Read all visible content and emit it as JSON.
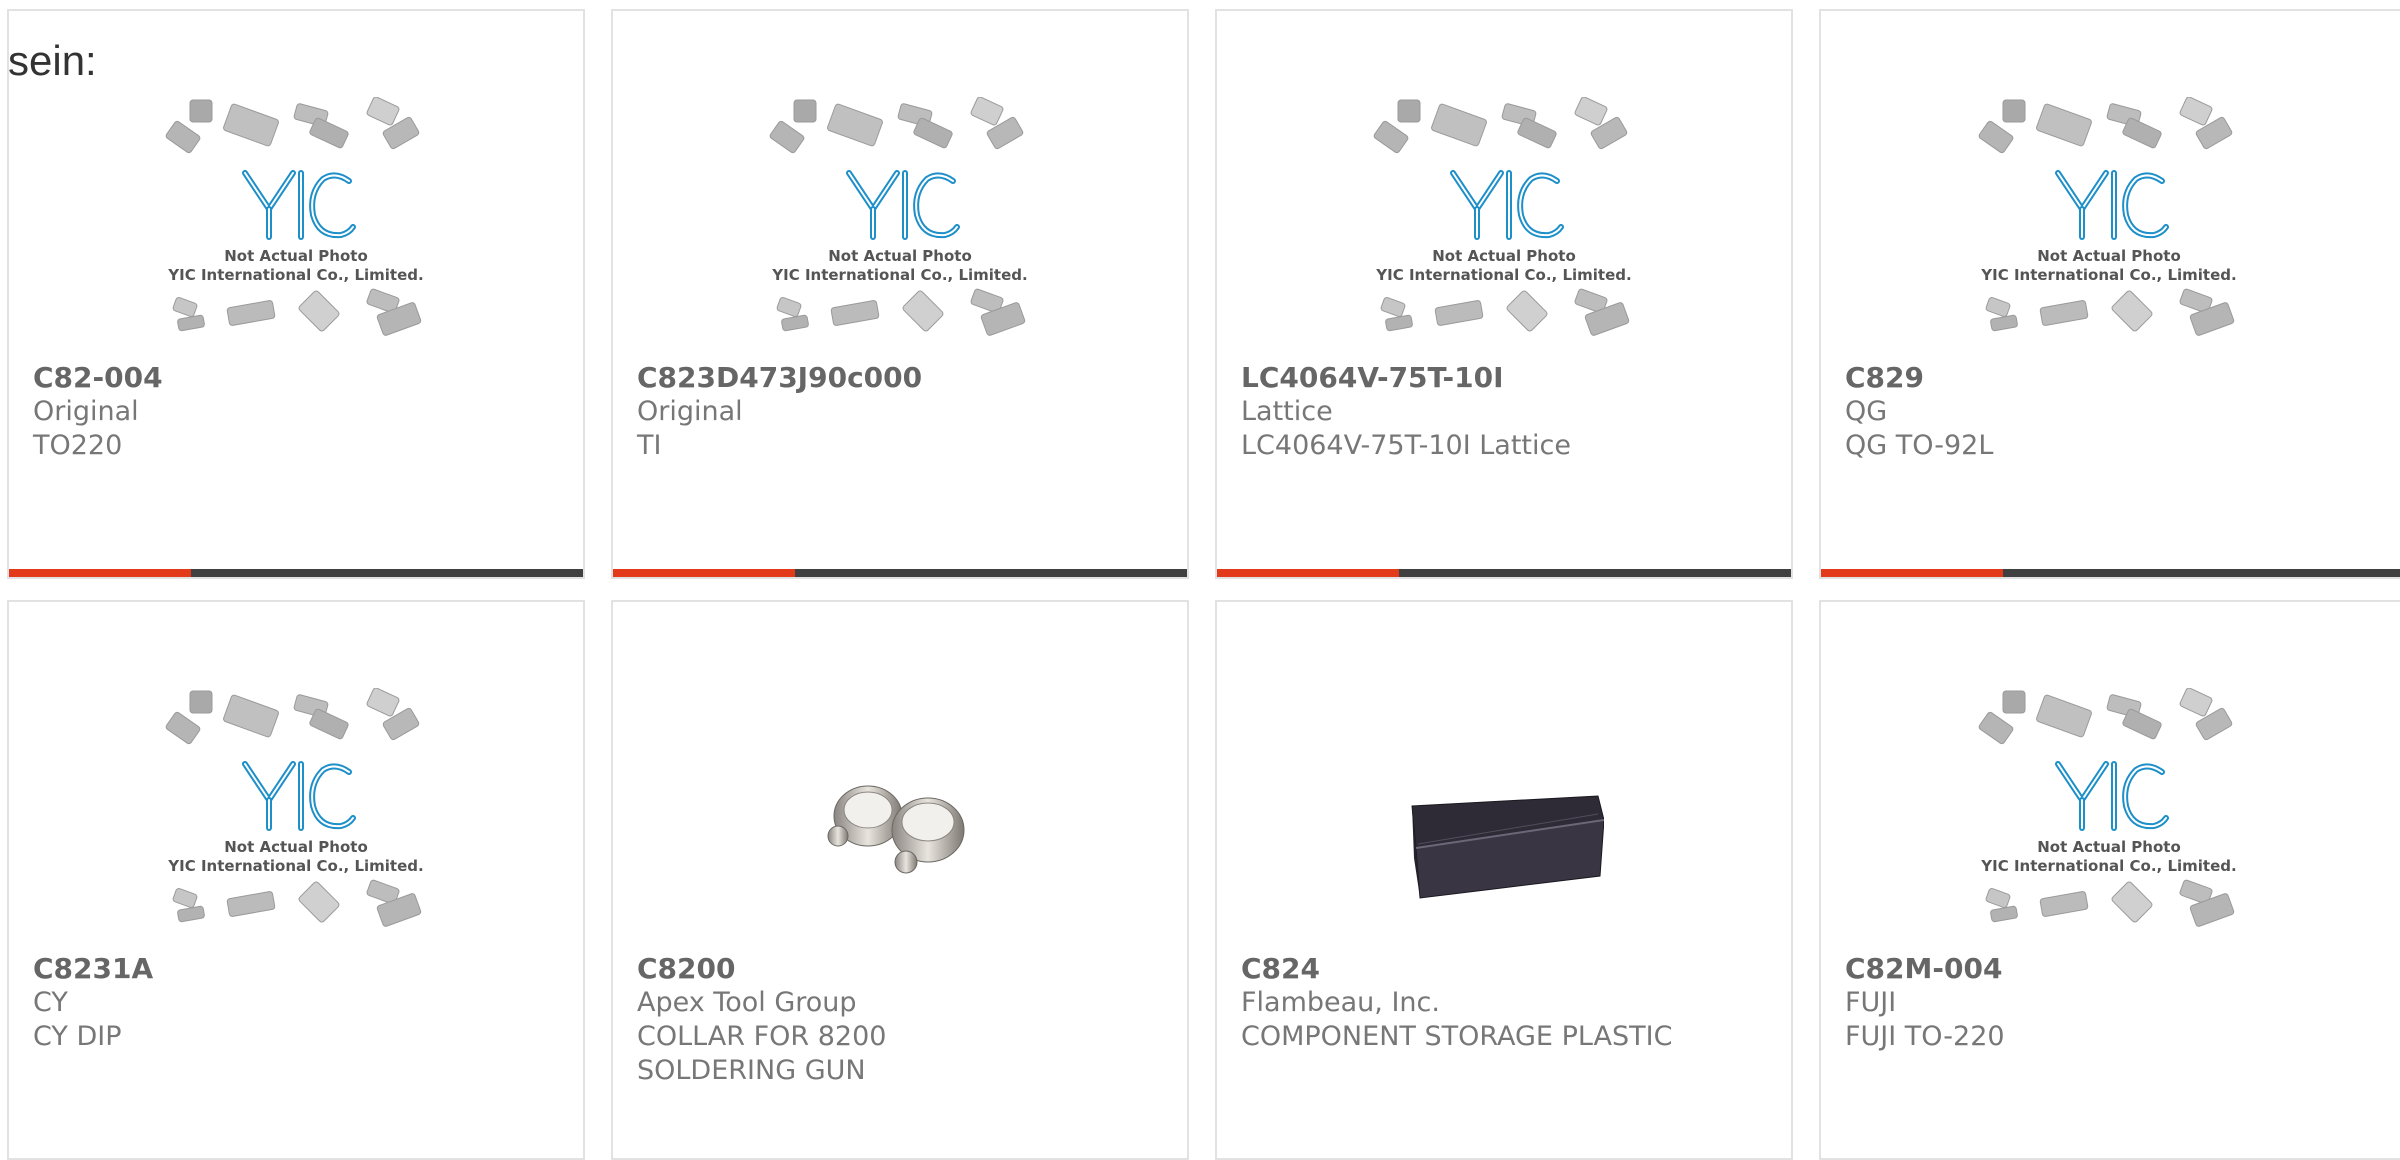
{
  "stray_text": "sein:",
  "accent_color": "#e23a1a",
  "bar_color": "#404040",
  "placeholder": {
    "caption_line1": "Not Actual Photo",
    "caption_line2": "YIC International Co., Limited.",
    "logo": "YIC"
  },
  "products": [
    {
      "part": "C82-004",
      "brand": "Original",
      "desc": "TO220",
      "image": "yic-placeholder"
    },
    {
      "part": "C823D473J90c000",
      "brand": "Original",
      "desc": "TI",
      "image": "yic-placeholder"
    },
    {
      "part": "LC4064V-75T-10I",
      "brand": "Lattice",
      "desc": "LC4064V-75T-10I Lattice",
      "image": "yic-placeholder"
    },
    {
      "part": "C829",
      "brand": "QG",
      "desc": "QG TO-92L",
      "image": "yic-placeholder"
    },
    {
      "part": "C8231A",
      "brand": "CY",
      "desc": "CY DIP",
      "image": "yic-placeholder"
    },
    {
      "part": "C8200",
      "brand": "Apex Tool Group",
      "desc": "COLLAR FOR 8200 SOLDERING GUN",
      "image": "collar-photo"
    },
    {
      "part": "C824",
      "brand": "Flambeau, Inc.",
      "desc": "COMPONENT STORAGE PLASTIC",
      "image": "storage-box-photo"
    },
    {
      "part": "C82M-004",
      "brand": "FUJI",
      "desc": "FUJI TO-220",
      "image": "yic-placeholder"
    }
  ]
}
